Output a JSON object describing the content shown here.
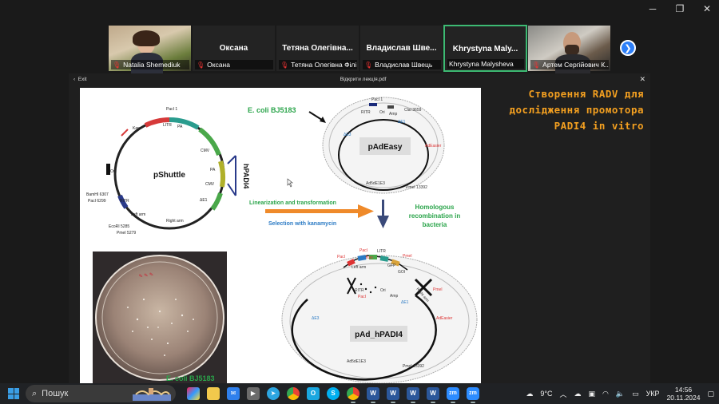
{
  "participants": [
    {
      "id": "p1",
      "label": "Natalia Shemediuk",
      "video": true
    },
    {
      "id": "p2",
      "name": "Оксана",
      "label": "Оксана",
      "video": false
    },
    {
      "id": "p3",
      "name": "Тетяна Олегівна...",
      "label": "Тетяна Олегівна Філі...",
      "video": false
    },
    {
      "id": "p4",
      "name": "Владислав Шве...",
      "label": "Владислав Швець",
      "video": false
    },
    {
      "id": "p5",
      "name": "Khrystyna Maly...",
      "label": "Khrystyna Malysheva",
      "video": false,
      "active": true
    },
    {
      "id": "p6",
      "label": "Артем Сергійович К...",
      "video": true
    }
  ],
  "viewer": {
    "exit_label": "Exit",
    "file_title": "Відкрити лекція.pdf"
  },
  "slide": {
    "ecoli_top": "E. coli BJ5183",
    "ecoli_bottom": "E. coli BJ5183",
    "linearization": "Linearization and transformation",
    "selection": "Selection with kanamycin",
    "homologous": [
      "Homologous",
      "recombination in",
      "bacteria"
    ],
    "pshuttle": {
      "name": "pShuttle",
      "insert": "hPADI4",
      "labels": [
        "PacI 1",
        "LITR",
        "PA",
        "Kan",
        "CMV",
        "PA",
        "CMV",
        "ΔE1",
        "Ori",
        "BamHI 6307",
        "PacI 6299",
        "RITR",
        "Left arm",
        "Right arm",
        "EcoRI 5285",
        "PmeI 5279"
      ]
    },
    "padeasy": {
      "name": "pAdEasy",
      "labels": [
        "PacI 1",
        "RITR",
        "Ori",
        "Amp",
        "ClaI 3659",
        "ΔE1",
        "ΔE3",
        "AdEasier",
        "Ad5dE1E3",
        "PmeI 13392"
      ]
    },
    "pad_hpadi4": {
      "name": "pAd_hPADI4",
      "labels": [
        "PacI",
        "PacI",
        "Kan",
        "LITR",
        "GFP",
        "GOI",
        "PmeI",
        "Left arm",
        "RITR",
        "PacI",
        "Ori",
        "Amp",
        "ΔE1",
        "Right arm",
        "PmeI",
        "AdEasier",
        "ΔE3",
        "Ad5dE1E3",
        "PmeI 13392"
      ]
    }
  },
  "side_title": "Створення RADV для дослідження промотора PADI4 in vitro",
  "taskbar": {
    "search_label": "Пошук",
    "weather": "9°C",
    "lang": "УКР",
    "time": "14:56",
    "date": "20.11.2024"
  },
  "colors": {
    "accent_orange": "#f4a020",
    "green_text": "#2aa44a",
    "zoom_blue": "#2d7ff9",
    "active_tile": "#3dba73"
  }
}
